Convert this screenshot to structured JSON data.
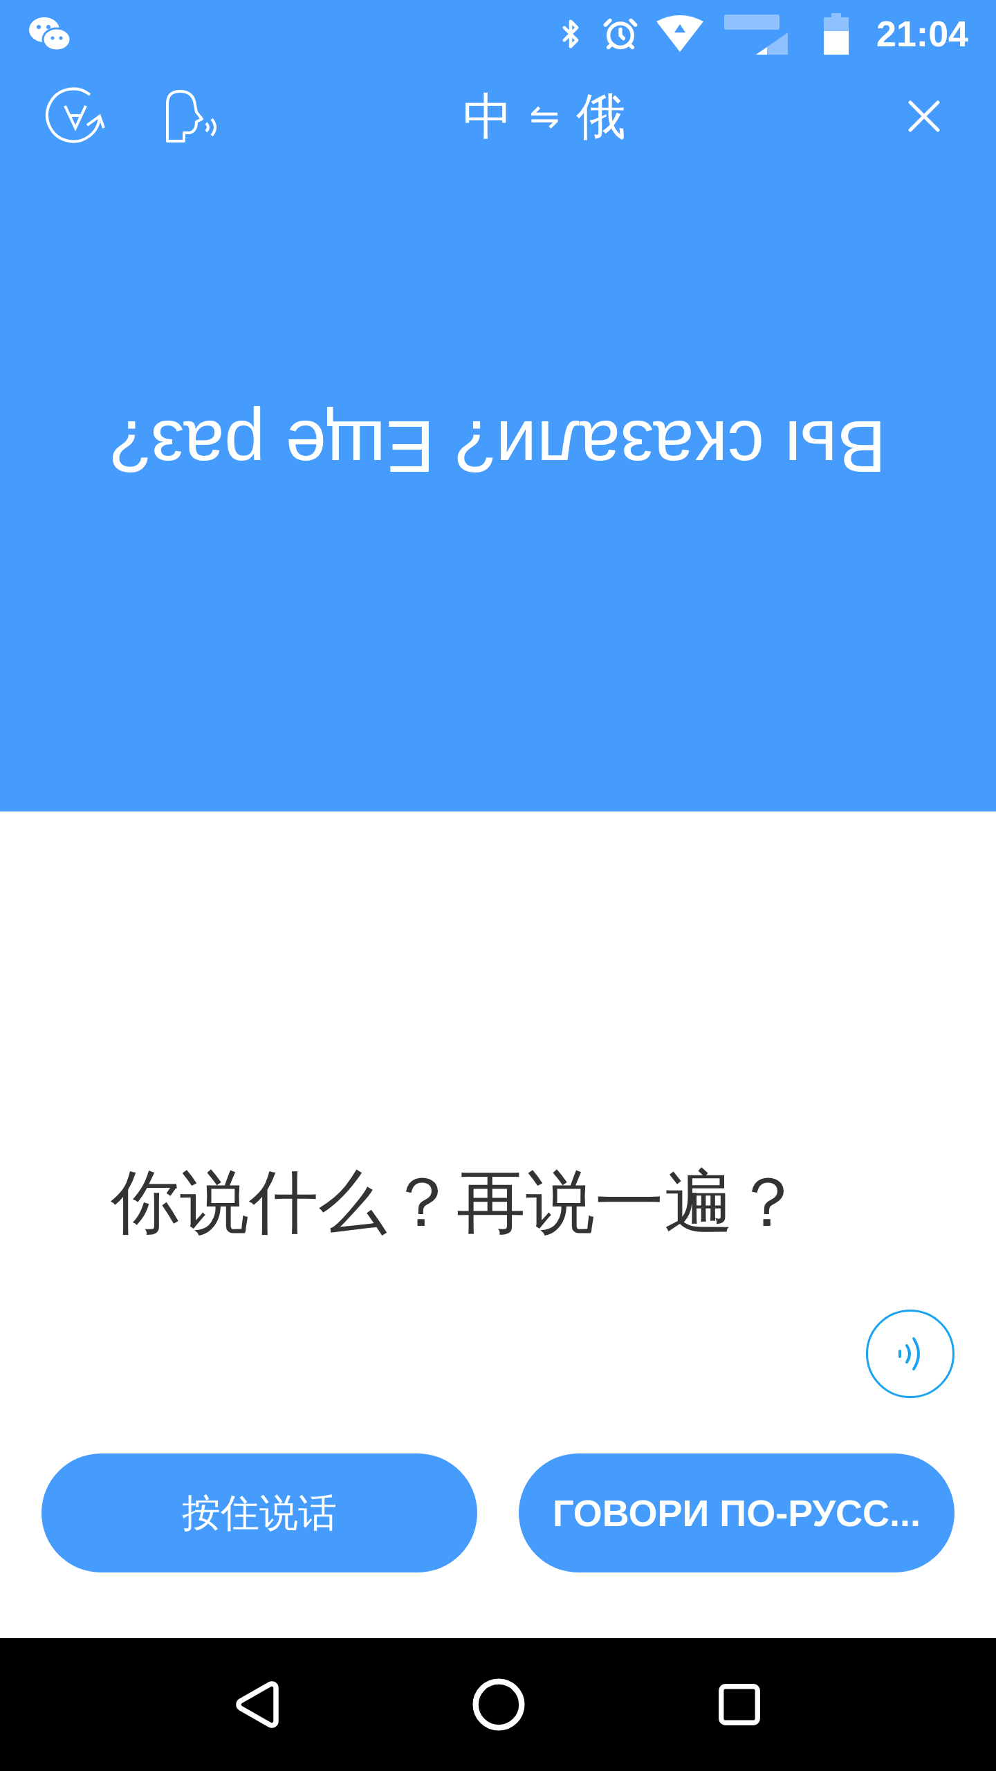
{
  "status_bar": {
    "time": "21:04"
  },
  "header": {
    "source_language": "中",
    "swap": "⇋",
    "target_language": "俄"
  },
  "translation": {
    "text": "Вы сказали? Еще раз?"
  },
  "source": {
    "text": "你说什么？再说一遍？"
  },
  "buttons": [
    {
      "label": "按住说话"
    },
    {
      "label": "ГОВОРИ ПО-РУСС..."
    }
  ]
}
